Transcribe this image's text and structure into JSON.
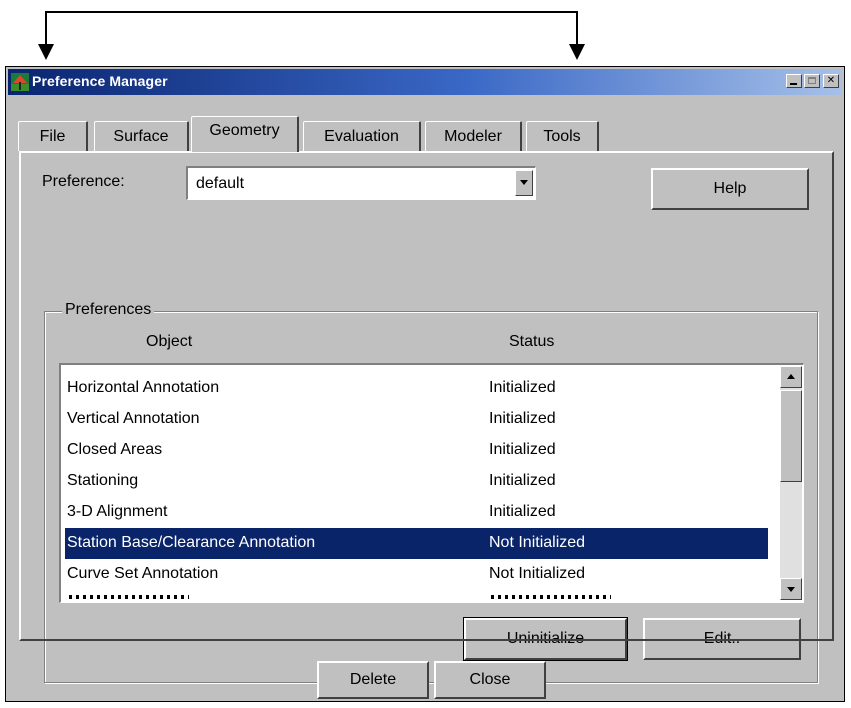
{
  "window": {
    "title": "Preference Manager",
    "controls": {
      "minimize_icon": "minimize-icon",
      "maximize_icon": "maximize-icon",
      "close_icon": "close-icon",
      "close_glyph": "✕"
    }
  },
  "tabs": [
    {
      "label": "File",
      "active": false
    },
    {
      "label": "Surface",
      "active": false
    },
    {
      "label": "Geometry",
      "active": true
    },
    {
      "label": "Evaluation",
      "active": false
    },
    {
      "label": "Modeler",
      "active": false
    },
    {
      "label": "Tools",
      "active": false
    }
  ],
  "preference": {
    "label": "Preference:",
    "value": "default"
  },
  "help_button": "Help",
  "preferences_group": {
    "title": "Preferences",
    "columns": [
      "Object",
      "Status"
    ],
    "rows": [
      {
        "object": "Horizontal Annotation",
        "status": "Initialized",
        "selected": false
      },
      {
        "object": "Vertical Annotation",
        "status": "Initialized",
        "selected": false
      },
      {
        "object": "Closed Areas",
        "status": "Initialized",
        "selected": false
      },
      {
        "object": "Stationing",
        "status": "Initialized",
        "selected": false
      },
      {
        "object": "3-D Alignment",
        "status": "Initialized",
        "selected": false
      },
      {
        "object": "Station Base/Clearance Annotation",
        "status": "Not Initialized",
        "selected": true
      },
      {
        "object": "Curve Set Annotation",
        "status": "Not Initialized",
        "selected": false
      }
    ],
    "uninitialize_button": "Uninitialize",
    "edit_button": "Edit.."
  },
  "footer": {
    "delete_button": "Delete",
    "close_button": "Close"
  },
  "colors": {
    "selection": "#0a246a",
    "title_gradient_start": "#0a2470",
    "title_gradient_end": "#a6c0e8",
    "face": "#c0c0c0"
  }
}
